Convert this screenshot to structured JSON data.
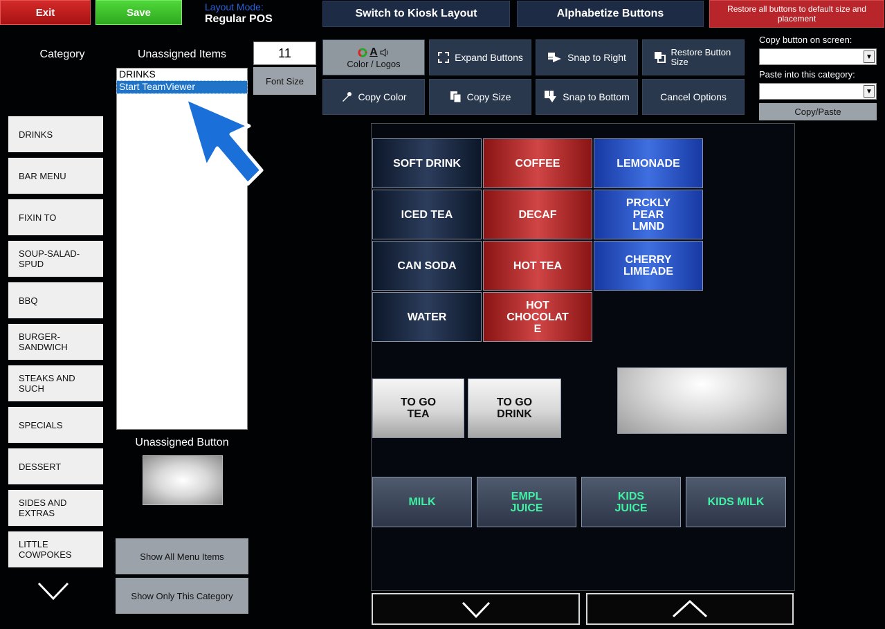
{
  "top": {
    "exit_label": "Exit",
    "save_label": "Save",
    "layout_mode_label": "Layout Mode:",
    "layout_mode_value": "Regular POS",
    "kiosk_label": "Switch to Kiosk Layout",
    "alphabetize_label": "Alphabetize Buttons",
    "restore_all_label": "Restore all buttons to default size and placement"
  },
  "category": {
    "title": "Category",
    "items": [
      "DRINKS",
      "BAR MENU",
      "FIXIN TO",
      "SOUP-SALAD-SPUD",
      "BBQ",
      "BURGER-SANDWICH",
      "STEAKS AND SUCH",
      "SPECIALS",
      "DESSERT",
      "SIDES AND EXTRAS",
      "LITTLE COWPOKES"
    ]
  },
  "unassigned": {
    "title": "Unassigned Items",
    "items": [
      "DRINKS",
      "Start TeamViewer"
    ],
    "selected": "Start TeamViewer",
    "button_title": "Unassigned Button",
    "show_all_label": "Show All Menu Items",
    "show_only_label": "Show Only This Category"
  },
  "font": {
    "size_value": "11",
    "size_label": "Font Size"
  },
  "tools": {
    "color_logos": "Color / Logos",
    "color_icon_text": "A",
    "expand": "Expand Buttons",
    "snap_right": "Snap to Right",
    "restore_button_size": "Restore Button Size",
    "copy_color": "Copy Color",
    "copy_size": "Copy Size",
    "snap_bottom": "Snap to Bottom",
    "cancel_options": "Cancel Options"
  },
  "copy_panel": {
    "copy_label": "Copy button on screen:",
    "paste_label": "Paste into this category:",
    "copy_paste_label": "Copy/Paste"
  },
  "menu_buttons": [
    "SOFT DRINK",
    "COFFEE",
    "LEMONADE",
    "ICED TEA",
    "DECAF",
    "PRCKLY PEAR LMND",
    "CAN SODA",
    "HOT TEA",
    "CHERRY LIMEADE",
    "WATER",
    "HOT CHOCOLAT E",
    "TO GO TEA",
    "TO GO DRINK",
    "MILK",
    "EMPL JUICE",
    "KIDS JUICE",
    "KIDS MILK"
  ],
  "colors": {
    "accent_blue": "#1f74c8",
    "exit_red": "#c41e1e",
    "save_green": "#3bbf2b",
    "milk_text": "#3ff2a5"
  }
}
